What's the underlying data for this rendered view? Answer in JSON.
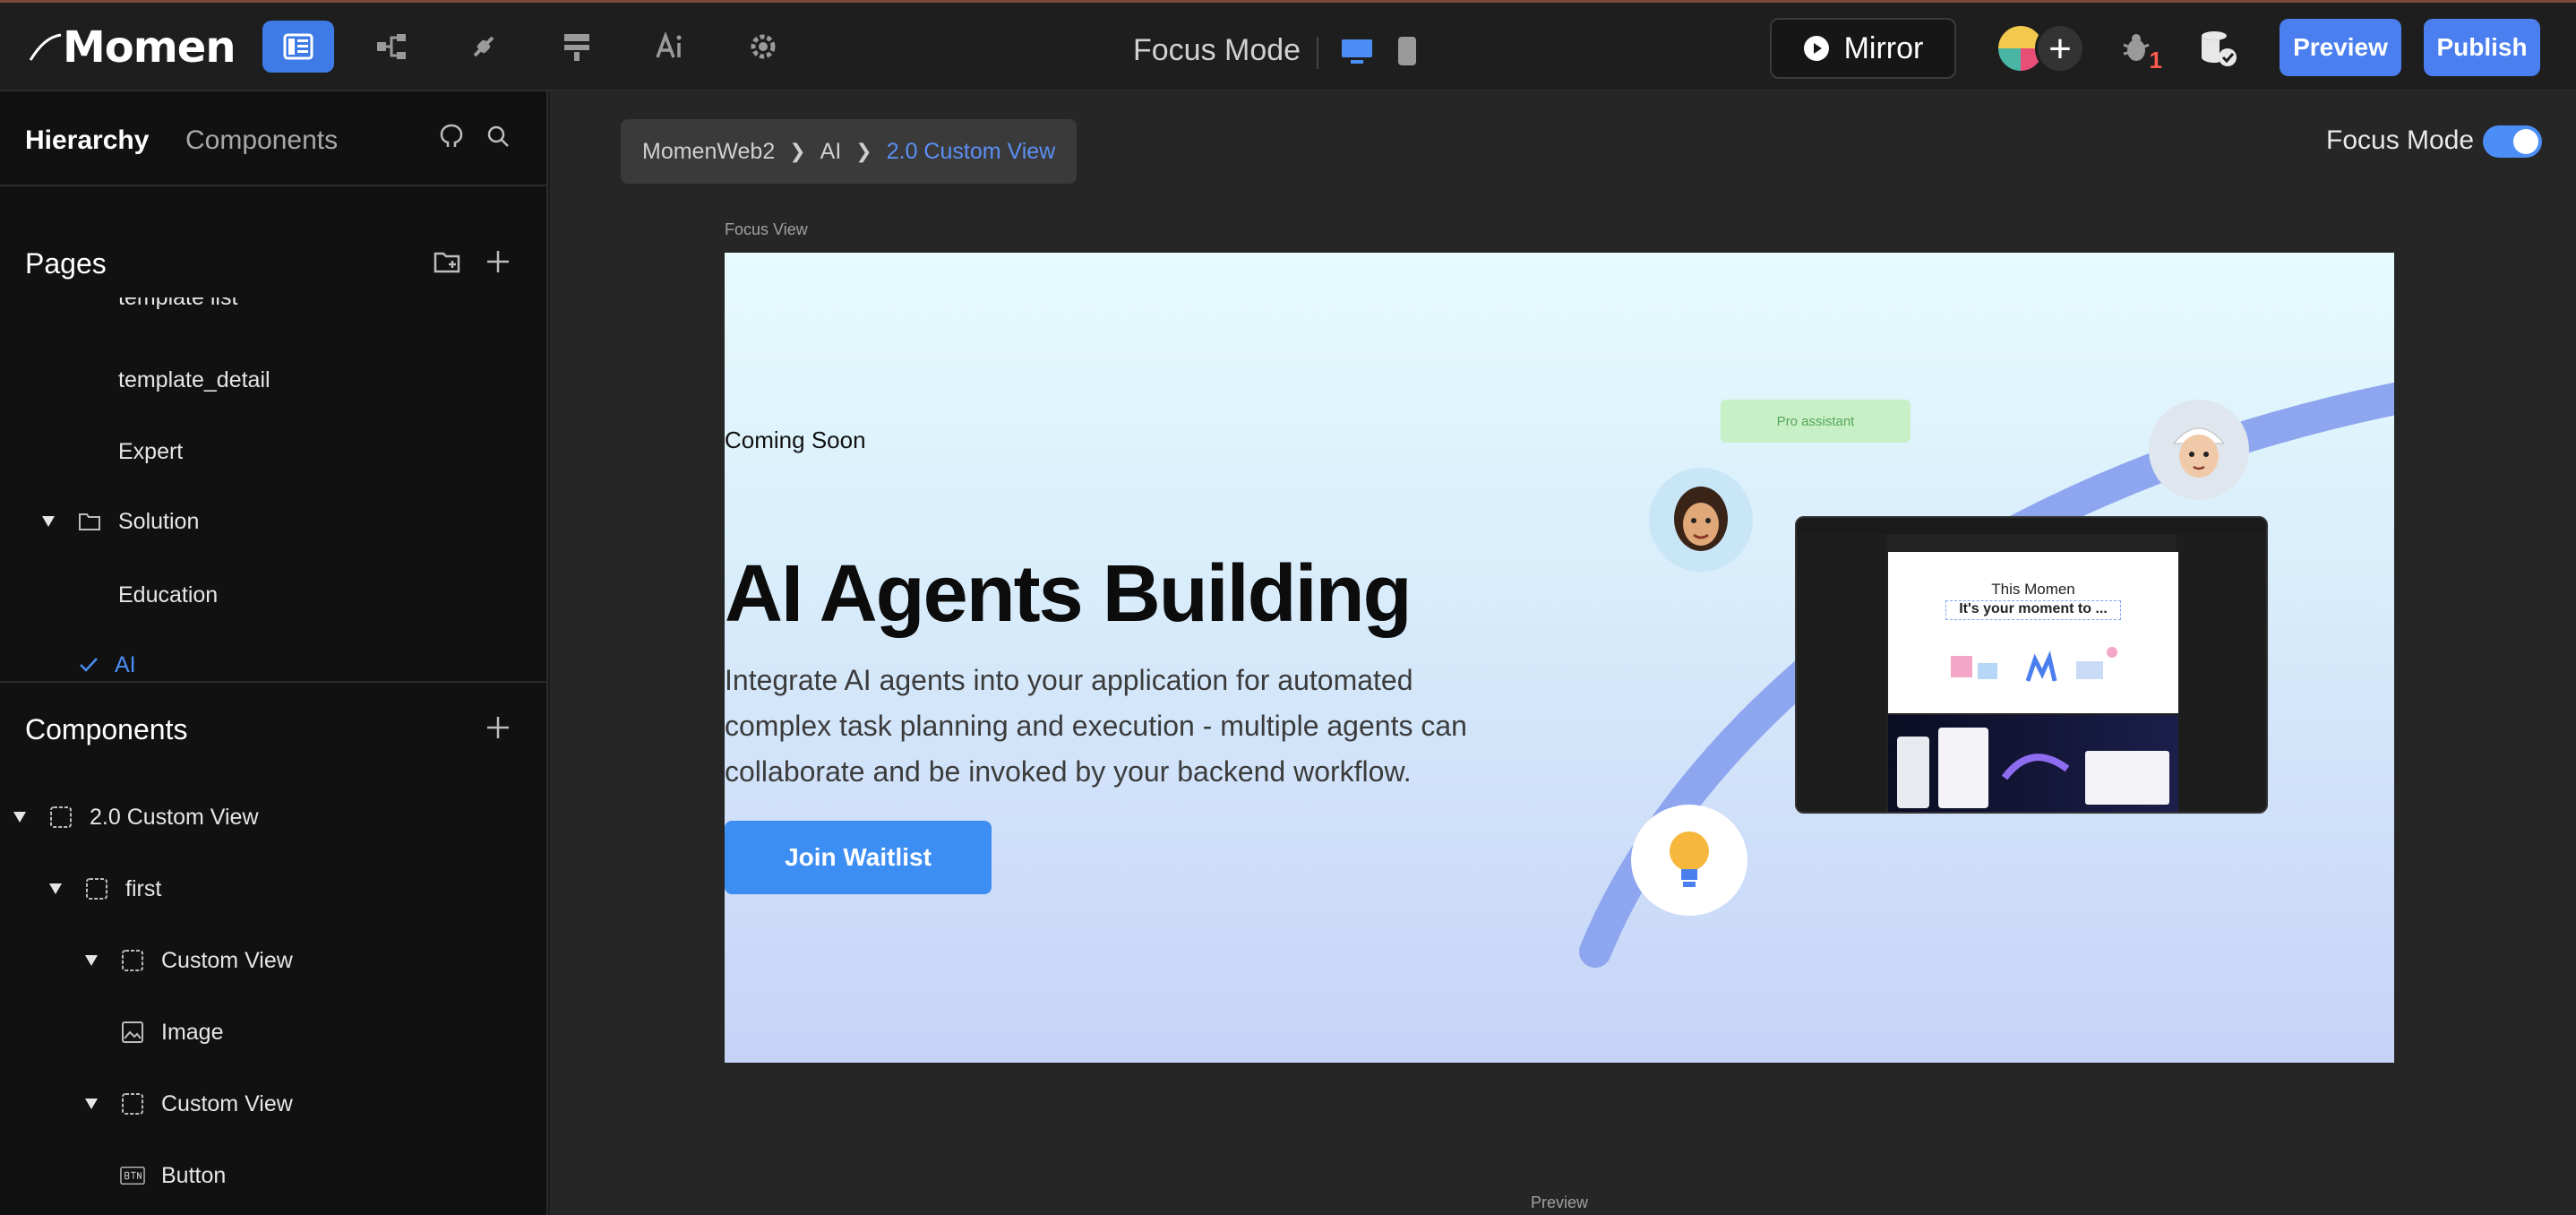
{
  "app": {
    "logo_text": "Momen",
    "focus_title": "Focus Mode",
    "mirror_label": "Mirror",
    "bug_count": "1",
    "preview_label": "Preview",
    "publish_label": "Publish"
  },
  "sidebar": {
    "tabs": {
      "active": "Hierarchy",
      "inactive": "Components"
    },
    "pages_heading": "Pages",
    "pages": [
      {
        "label": "template list"
      },
      {
        "label": "template_detail"
      },
      {
        "label": "Expert"
      },
      {
        "label": "Solution"
      },
      {
        "label": "Education"
      },
      {
        "label": "AI"
      }
    ],
    "components_heading": "Components",
    "tree": [
      {
        "label": "2.0 Custom View"
      },
      {
        "label": "first"
      },
      {
        "label": "Custom View"
      },
      {
        "label": "Image"
      },
      {
        "label": "Custom View"
      },
      {
        "label": "Button"
      }
    ]
  },
  "canvas": {
    "breadcrumb": [
      "MomenWeb2",
      "AI",
      "2.0 Custom View"
    ],
    "focus_mode_label": "Focus Mode",
    "focus_mode_on": true,
    "focus_view_label": "Focus View",
    "preview_label": "Preview"
  },
  "frame": {
    "coming_soon": "Coming Soon",
    "title": "AI Agents Building",
    "description": "Integrate AI agents into your application for automated complex task planning and execution - multiple agents can collaborate and be invoked by your backend workflow.",
    "cta": "Join Waitlist",
    "pro_bubble": "Pro assistant",
    "shot_title": "This Momen",
    "shot_subtitle": "It's your moment to ..."
  },
  "colors": {
    "accent": "#4b7ff0",
    "selected": "#4b8ef5",
    "cta": "#3d8ef3"
  }
}
